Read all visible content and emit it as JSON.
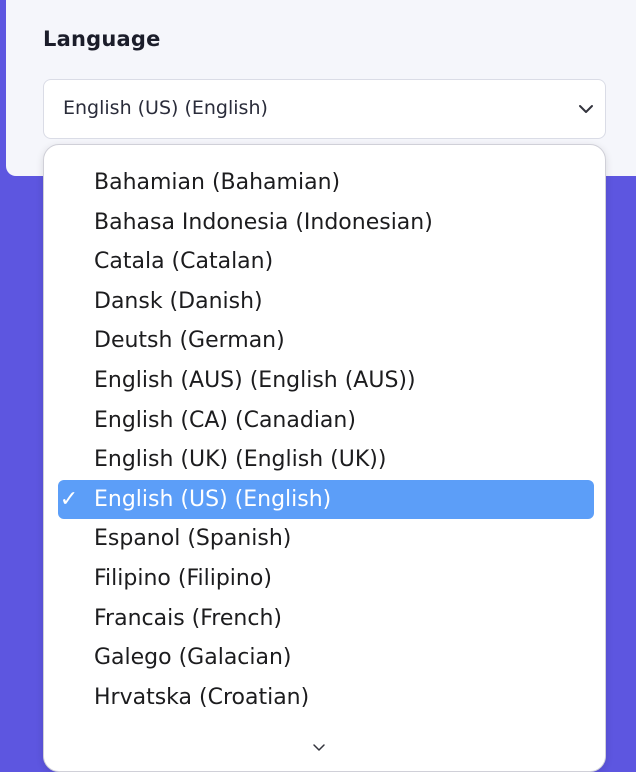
{
  "field": {
    "label": "Language",
    "selected_value": "English (US) (English)"
  },
  "dropdown": {
    "options": [
      {
        "label": "Bahamian (Bahamian)",
        "selected": false
      },
      {
        "label": "Bahasa Indonesia (Indonesian)",
        "selected": false
      },
      {
        "label": "Catala (Catalan)",
        "selected": false
      },
      {
        "label": "Dansk (Danish)",
        "selected": false
      },
      {
        "label": "Deutsh (German)",
        "selected": false
      },
      {
        "label": "English (AUS) (English (AUS))",
        "selected": false
      },
      {
        "label": "English (CA) (Canadian)",
        "selected": false
      },
      {
        "label": "English (UK) (English (UK))",
        "selected": false
      },
      {
        "label": "English (US) (English)",
        "selected": true
      },
      {
        "label": "Espanol (Spanish)",
        "selected": false
      },
      {
        "label": "Filipino (Filipino)",
        "selected": false
      },
      {
        "label": "Francais (French)",
        "selected": false
      },
      {
        "label": "Galego (Galacian)",
        "selected": false
      },
      {
        "label": "Hrvatska (Croatian)",
        "selected": false
      }
    ],
    "checkmark": "✓",
    "more_indicator_icon": "chevron-down-icon"
  },
  "colors": {
    "background": "#5d56e0",
    "card": "#f5f6fb",
    "selected_option": "#5c9ef8"
  }
}
